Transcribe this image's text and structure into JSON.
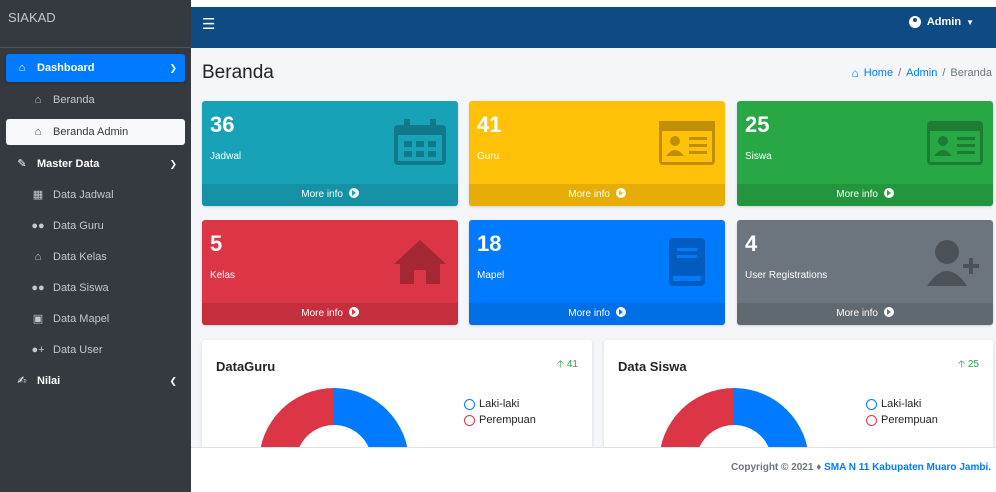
{
  "brand": "SIAKAD",
  "sidebar": {
    "items": [
      {
        "label": "Dashboard",
        "icon": "home-icon"
      },
      {
        "label": "Beranda",
        "icon": "home-icon"
      },
      {
        "label": "Beranda Admin",
        "icon": "home-icon"
      },
      {
        "label": "Master Data",
        "icon": "edit-icon"
      },
      {
        "label": "Data Jadwal",
        "icon": "calendar-icon"
      },
      {
        "label": "Data Guru",
        "icon": "users-icon"
      },
      {
        "label": "Data Kelas",
        "icon": "home-icon"
      },
      {
        "label": "Data Siswa",
        "icon": "users-icon"
      },
      {
        "label": "Data Mapel",
        "icon": "book-icon"
      },
      {
        "label": "Data User",
        "icon": "user-plus-icon"
      },
      {
        "label": "Nilai",
        "icon": "signature-icon"
      }
    ]
  },
  "header": {
    "user": "Admin"
  },
  "page": {
    "title": "Beranda",
    "breadcrumb": [
      "Home",
      "Admin",
      "Beranda"
    ]
  },
  "boxes": [
    {
      "value": "36",
      "label": "Jadwal",
      "footer": "More info",
      "color": "#17a2b8",
      "icon": "calendar-icon"
    },
    {
      "value": "41",
      "label": "Guru",
      "footer": "More info",
      "color": "#ffc107",
      "icon": "id-card-icon"
    },
    {
      "value": "25",
      "label": "Siswa",
      "footer": "More info",
      "color": "#28a745",
      "icon": "id-card-icon"
    },
    {
      "value": "5",
      "label": "Kelas",
      "footer": "More info",
      "color": "#dc3545",
      "icon": "home-icon"
    },
    {
      "value": "18",
      "label": "Mapel",
      "footer": "More info",
      "color": "#007bff",
      "icon": "book-icon"
    },
    {
      "value": "4",
      "label": "User Registrations",
      "footer": "More info",
      "color": "#6c757d",
      "icon": "user-plus-icon"
    }
  ],
  "cards": [
    {
      "title": "DataGuru",
      "delta": "41",
      "legend": [
        "Laki-laki",
        "Perempuan"
      ]
    },
    {
      "title": "Data Siswa",
      "delta": "25",
      "legend": [
        "Laki-laki",
        "Perempuan"
      ]
    }
  ],
  "colors": {
    "male": "#007bff",
    "female": "#dc3545"
  },
  "footer": {
    "copyright": "Copyright © 2021 ♦",
    "school": "SMA N 11 Kabupaten Muaro Jambi."
  }
}
